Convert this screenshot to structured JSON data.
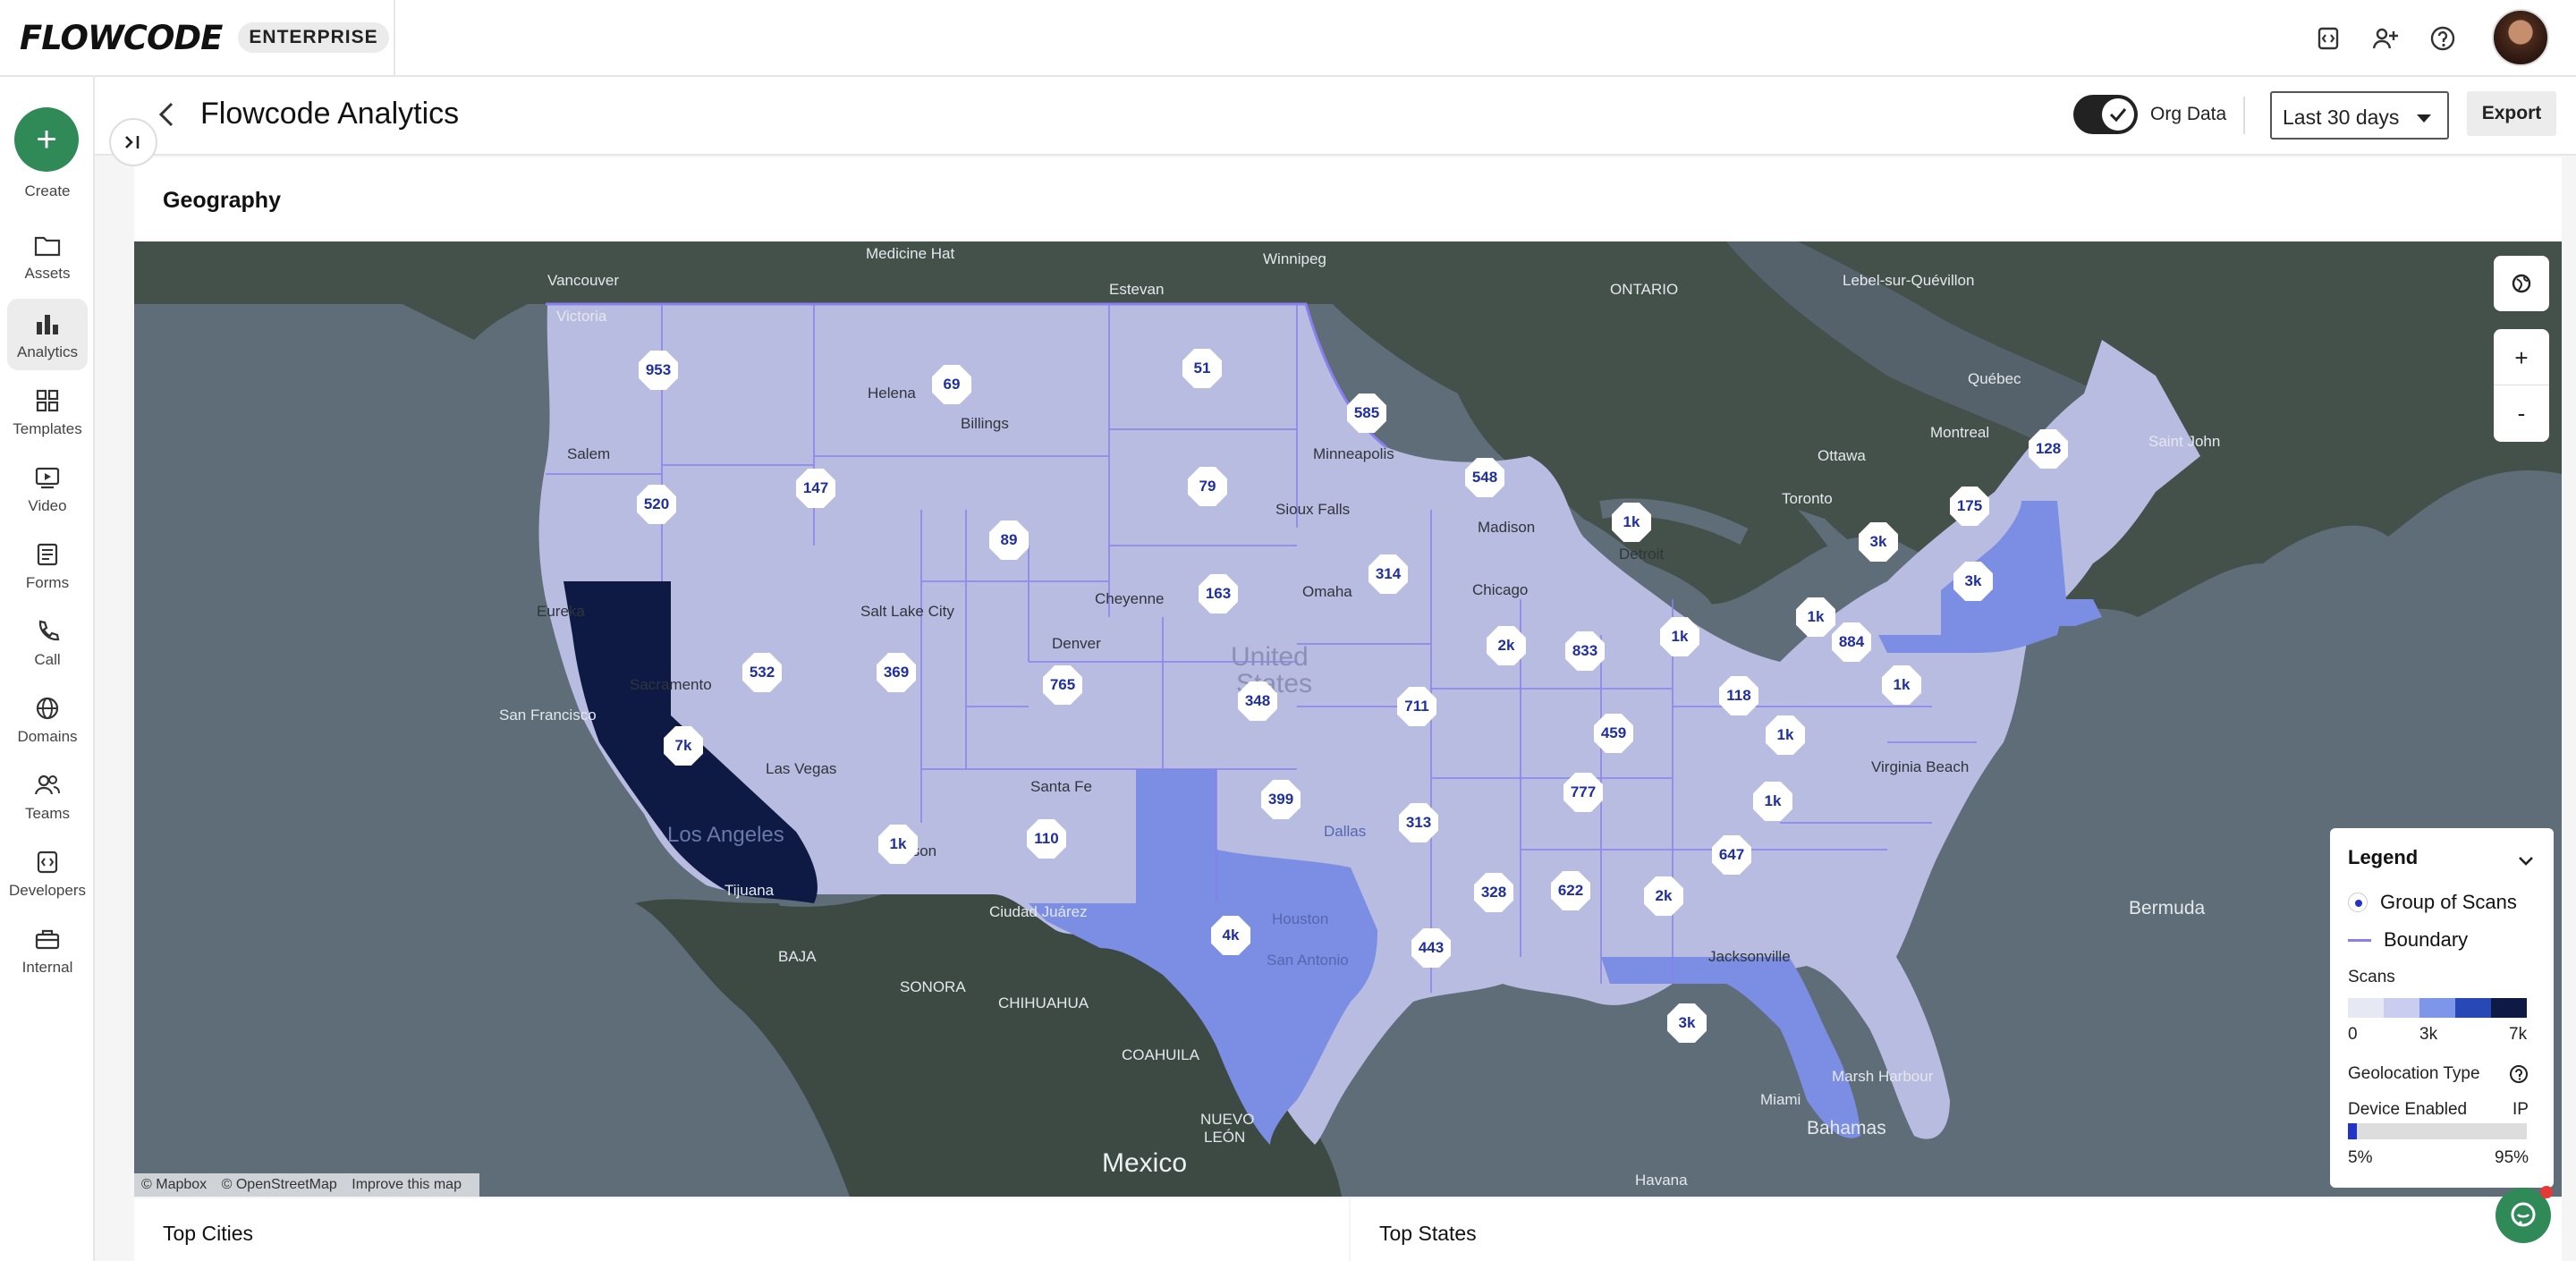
{
  "brand": {
    "logo": "FLOWCODE",
    "tier": "ENTERPRISE"
  },
  "sidebar": {
    "create_label": "Create",
    "items": [
      {
        "label": "Assets",
        "icon": "folder-icon"
      },
      {
        "label": "Analytics",
        "icon": "bar-chart-icon",
        "active": true
      },
      {
        "label": "Templates",
        "icon": "grid-icon"
      },
      {
        "label": "Video",
        "icon": "video-icon"
      },
      {
        "label": "Forms",
        "icon": "form-icon"
      },
      {
        "label": "Call",
        "icon": "phone-icon"
      },
      {
        "label": "Domains",
        "icon": "globe-icon"
      },
      {
        "label": "Teams",
        "icon": "users-icon"
      },
      {
        "label": "Developers",
        "icon": "code-icon"
      },
      {
        "label": "Internal",
        "icon": "toolbox-icon"
      }
    ]
  },
  "page": {
    "title": "Flowcode Analytics",
    "org_data_label": "Org Data",
    "org_data_on": true,
    "date_range": "Last 30 days",
    "export_label": "Export"
  },
  "geography": {
    "title": "Geography",
    "attribution": [
      "© Mapbox",
      "© OpenStreetMap",
      "Improve this map"
    ],
    "zoom_in": "+",
    "zoom_out": "-",
    "state_scans": [
      {
        "state": "WA",
        "label": "953"
      },
      {
        "state": "OR",
        "label": "520"
      },
      {
        "state": "CA",
        "label": "7k"
      },
      {
        "state": "ID",
        "label": "147"
      },
      {
        "state": "NV",
        "label": "532"
      },
      {
        "state": "MT",
        "label": "69"
      },
      {
        "state": "WY",
        "label": "89"
      },
      {
        "state": "UT",
        "label": "369"
      },
      {
        "state": "AZ",
        "label": "1k"
      },
      {
        "state": "CO",
        "label": "765"
      },
      {
        "state": "NM",
        "label": "110"
      },
      {
        "state": "ND",
        "label": "51"
      },
      {
        "state": "SD",
        "label": "79"
      },
      {
        "state": "NE",
        "label": "163"
      },
      {
        "state": "KS",
        "label": "348"
      },
      {
        "state": "OK",
        "label": "399"
      },
      {
        "state": "TX",
        "label": "4k"
      },
      {
        "state": "MN",
        "label": "585"
      },
      {
        "state": "IA",
        "label": "314"
      },
      {
        "state": "MO",
        "label": "711"
      },
      {
        "state": "AR",
        "label": "313"
      },
      {
        "state": "LA",
        "label": "443"
      },
      {
        "state": "WI",
        "label": "548"
      },
      {
        "state": "IL",
        "label": "2k"
      },
      {
        "state": "MI",
        "label": "1k"
      },
      {
        "state": "IN",
        "label": "833"
      },
      {
        "state": "KY",
        "label": "459"
      },
      {
        "state": "TN",
        "label": "777"
      },
      {
        "state": "MS",
        "label": "328"
      },
      {
        "state": "AL",
        "label": "622"
      },
      {
        "state": "GA",
        "label": "2k"
      },
      {
        "state": "FL",
        "label": "3k"
      },
      {
        "state": "SC",
        "label": "647"
      },
      {
        "state": "NC",
        "label": "1k"
      },
      {
        "state": "VA",
        "label": "1k"
      },
      {
        "state": "WV",
        "label": "118"
      },
      {
        "state": "OH",
        "label": "1k"
      },
      {
        "state": "PA",
        "label": "1k"
      },
      {
        "state": "NY",
        "label": "3k"
      },
      {
        "state": "NJ",
        "label": "1k"
      },
      {
        "state": "MD",
        "label": "884"
      },
      {
        "state": "VT",
        "label": "175"
      },
      {
        "state": "MA",
        "label": "3k"
      },
      {
        "state": "ME",
        "label": "128"
      }
    ],
    "place_labels": {
      "medicine_hat": "Medicine Hat",
      "winnipeg": "Winnipeg",
      "vancouver": "Vancouver",
      "victoria": "Victoria",
      "estevan": "Estevan",
      "ontario": "ONTARIO",
      "lebel": "Lebel-sur-Quévillon",
      "quebec": "Québec",
      "montreal": "Montreal",
      "ottawa": "Ottawa",
      "toronto": "Toronto",
      "saint_john": "Saint John",
      "minneapolis": "Minneapolis",
      "chicago": "Chicago",
      "detroit": "Detroit",
      "madison": "Madison",
      "sacramento": "Sacramento",
      "san_francisco": "San Francisco",
      "las_vegas": "Las Vegas",
      "los_angeles": "Los Angeles",
      "tijuana": "Tijuana",
      "tucson": "Tucson",
      "denver": "Denver",
      "cheyenne": "Cheyenne",
      "salt_lake": "Salt Lake City",
      "santa_fe": "Santa Fe",
      "ciudad_juarez": "Ciudad Juárez",
      "united_states_1": "United",
      "united_states_2": "States",
      "dallas": "Dallas",
      "houston": "Houston",
      "san_antonio": "San Antonio",
      "virginia_beach": "Virginia Beach",
      "jacksonville": "Jacksonville",
      "miami": "Miami",
      "bermuda": "Bermuda",
      "marsh_harbour": "Marsh Harbour",
      "bahamas": "Bahamas",
      "havana": "Havana",
      "mexico": "Mexico",
      "sonora": "SONORA",
      "chihuahua": "CHIHUAHUA",
      "coahuila": "COAHUILA",
      "nuevo_leon": "NUEVO",
      "leon": "LEÓN",
      "baja": "BAJA",
      "eureka": "Eureka",
      "salem": "Salem",
      "helena": "Helena",
      "billings": "Billings",
      "omaha": "Omaha",
      "sioux_falls": "Sioux Falls"
    }
  },
  "legend": {
    "title": "Legend",
    "group_label": "Group of Scans",
    "boundary_label": "Boundary",
    "scans_label": "Scans",
    "scale_colors": [
      "#e6e8f4",
      "#c9cdf0",
      "#7e96ea",
      "#2848b8",
      "#0e1a44"
    ],
    "scale_ticks": [
      "0",
      "3k",
      "7k"
    ],
    "geoloc_label": "Geolocation Type",
    "device_label": "Device Enabled",
    "ip_label": "IP",
    "device_pct": 5,
    "device_pct_label": "5%",
    "ip_pct_label": "95%"
  },
  "bottom": {
    "top_cities": "Top Cities",
    "top_states": "Top States"
  },
  "colors": {
    "accent": "#2f8a57",
    "badge_text": "#1f2fa0",
    "boundary": "#8a7ff0"
  }
}
